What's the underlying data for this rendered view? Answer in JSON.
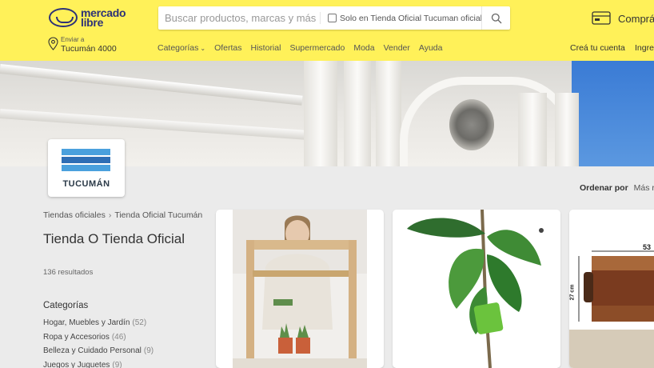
{
  "header": {
    "logo_text_1": "mercado",
    "logo_text_2": "libre",
    "search_placeholder": "Buscar productos, marcas y más...",
    "official_store_toggle": "Solo en Tienda Oficial Tucuman oficial",
    "cart_text": "Comprá",
    "location_label": "Enviar a",
    "location_value": "Tucumán 4000",
    "nav": [
      "Categorías",
      "Ofertas",
      "Historial",
      "Supermercado",
      "Moda",
      "Vender",
      "Ayuda"
    ],
    "create_account": "Creá tu cuenta",
    "login": "Ingre"
  },
  "store": {
    "logo_text": "TUCUMÁN",
    "brand_colors": {
      "light_blue": "#4aa0dd",
      "dark_blue": "#2f6eb5"
    }
  },
  "sort": {
    "label": "Ordenar por",
    "value": "Más rele"
  },
  "breadcrumb": [
    "Tiendas oficiales",
    "Tienda Oficial Tucumán"
  ],
  "page": {
    "title": "Tienda O Tienda Oficial",
    "results": "136 resultados"
  },
  "filters": {
    "heading": "Categorías",
    "items": [
      {
        "label": "Hogar, Muebles y Jardín",
        "count": "(52)"
      },
      {
        "label": "Ropa y Accesorios",
        "count": "(46)"
      },
      {
        "label": "Belleza y Cuidado Personal",
        "count": "(9)"
      },
      {
        "label": "Juegos y Juguetes",
        "count": "(9)"
      }
    ]
  },
  "products": [
    {
      "image": "woman-with-wooden-desk-and-plants"
    },
    {
      "image": "ficus-plant-with-green-label"
    },
    {
      "image": "wooden-cutting-board",
      "dimension_top": "53",
      "dimension_side": "27 cm"
    }
  ],
  "colors": {
    "header_yellow": "#fff159",
    "brand_navy": "#2d3277",
    "background": "#ebebeb"
  }
}
